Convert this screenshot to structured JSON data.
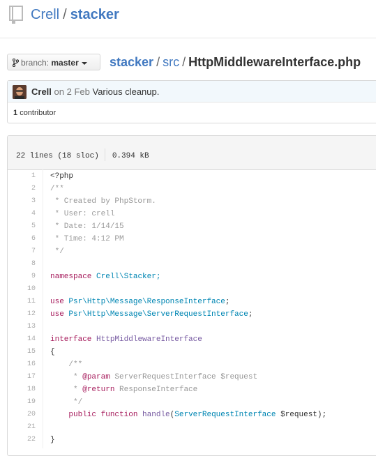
{
  "repo": {
    "owner": "Crell",
    "separator": "/",
    "name": "stacker"
  },
  "branch": {
    "prefix": "branch:",
    "name": "master"
  },
  "breadcrumb": {
    "root": "stacker",
    "sep1": "/",
    "dir": "src",
    "sep2": "/",
    "file": "HttpMiddlewareInterface.php"
  },
  "commit": {
    "author": "Crell",
    "date": "on 2 Feb",
    "message": "Various cleanup."
  },
  "contributors": {
    "count": "1",
    "label": "contributor"
  },
  "file_info": {
    "lines": "22 lines (18 sloc)",
    "size": "0.394 kB"
  },
  "code_lines": [
    "1",
    "2",
    "3",
    "4",
    "5",
    "6",
    "7",
    "8",
    "9",
    "10",
    "11",
    "12",
    "13",
    "14",
    "15",
    "16",
    "17",
    "18",
    "19",
    "20",
    "21",
    "22"
  ],
  "code": {
    "l1": "<?php",
    "l2": "/**",
    "l3": " * Created by PhpStorm.",
    "l4": " * User: crell",
    "l5": " * Date: 1/14/15",
    "l6": " * Time: 4:12 PM",
    "l7": " */",
    "l9_kw": "namespace",
    "l9_ns": "Crell\\Stacker;",
    "l11_kw": "use",
    "l11_ns": "Psr\\Http\\Message\\ResponseInterface",
    "l12_kw": "use",
    "l12_ns": "Psr\\Http\\Message\\ServerRequestInterface",
    "semi": ";",
    "l14_kw": "interface",
    "l14_name": "HttpMiddlewareInterface",
    "l15": "{",
    "l16": "    /**",
    "l17_pre": "     * ",
    "l17_tag": "@param",
    "l17_rest": " ServerRequestInterface $request",
    "l18_pre": "     * ",
    "l18_tag": "@return",
    "l18_rest": " ResponseInterface",
    "l19": "     */",
    "l20_indent": "    ",
    "l20_kw1": "public",
    "l20_kw2": "function",
    "l20_fn": "handle",
    "l20_open": "(",
    "l20_type": "ServerRequestInterface",
    "l20_rest": " $request);",
    "l22": "}"
  },
  "colors": {
    "link": "#4078c0",
    "keyword": "#a71d5d",
    "namespace": "#0086b3",
    "comment": "#999999",
    "function": "#795da3"
  }
}
